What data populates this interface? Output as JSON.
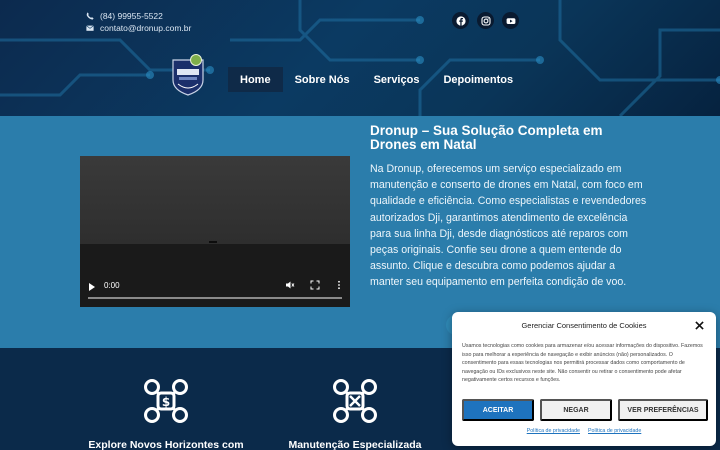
{
  "header": {
    "phone": "(84) 99955-5522",
    "email": "contato@dronup.com.br",
    "socials": [
      {
        "icon": "facebook-icon"
      },
      {
        "icon": "instagram-icon"
      },
      {
        "icon": "youtube-icon"
      }
    ],
    "nav": [
      {
        "label": "Home",
        "active": true
      },
      {
        "label": "Sobre Nós",
        "active": false
      },
      {
        "label": "Serviços",
        "active": false
      },
      {
        "label": "Depoimentos",
        "active": false
      }
    ]
  },
  "hero": {
    "title": "Dronup – Sua Solução Completa em Drones em Natal",
    "text": "Na Dronup, oferecemos um serviço especializado em manutenção e conserto de drones em Natal, com foco em qualidade e eficiência. Como especialistas e revendedores autorizados Dji, garantimos atendimento de excelência para sua linha Dji, desde diagnósticos até reparos com peças originais. Confie seu drone a quem entende do assunto. Clique e descubra como podemos ajudar a manter seu equipamento em perfeita condição de voo.",
    "video": {
      "time": "0:00"
    }
  },
  "features": [
    {
      "title": "Explore Novos Horizontes com",
      "icon": "drone-money-icon"
    },
    {
      "title": "Manutenção Especializada",
      "icon": "drone-tools-icon"
    }
  ],
  "cookie": {
    "title": "Gerenciar Consentimento de Cookies",
    "text": "Usamos tecnologias como cookies para armazenar e/ou acessar informações do dispositivo. Fazemos isso para melhorar a experiência de navegação e exibir anúncios (não) personalizados. O consentimento para essas tecnologias nos permitirá processar dados como comportamento de navegação ou IDs exclusivos neste site. Não consentir ou retirar o consentimento pode afetar negativamente certos recursos e funções.",
    "accept": "ACEITAR",
    "deny": "NEGAR",
    "prefs": "VER PREFERÊNCIAS",
    "links": [
      "Política de privacidade",
      "Política de privacidade"
    ]
  },
  "colors": {
    "accent": "#1e73be",
    "hero_bg": "#2b7dab",
    "header_bg": "#0b3a62",
    "features_bg": "#0b2a4a"
  }
}
